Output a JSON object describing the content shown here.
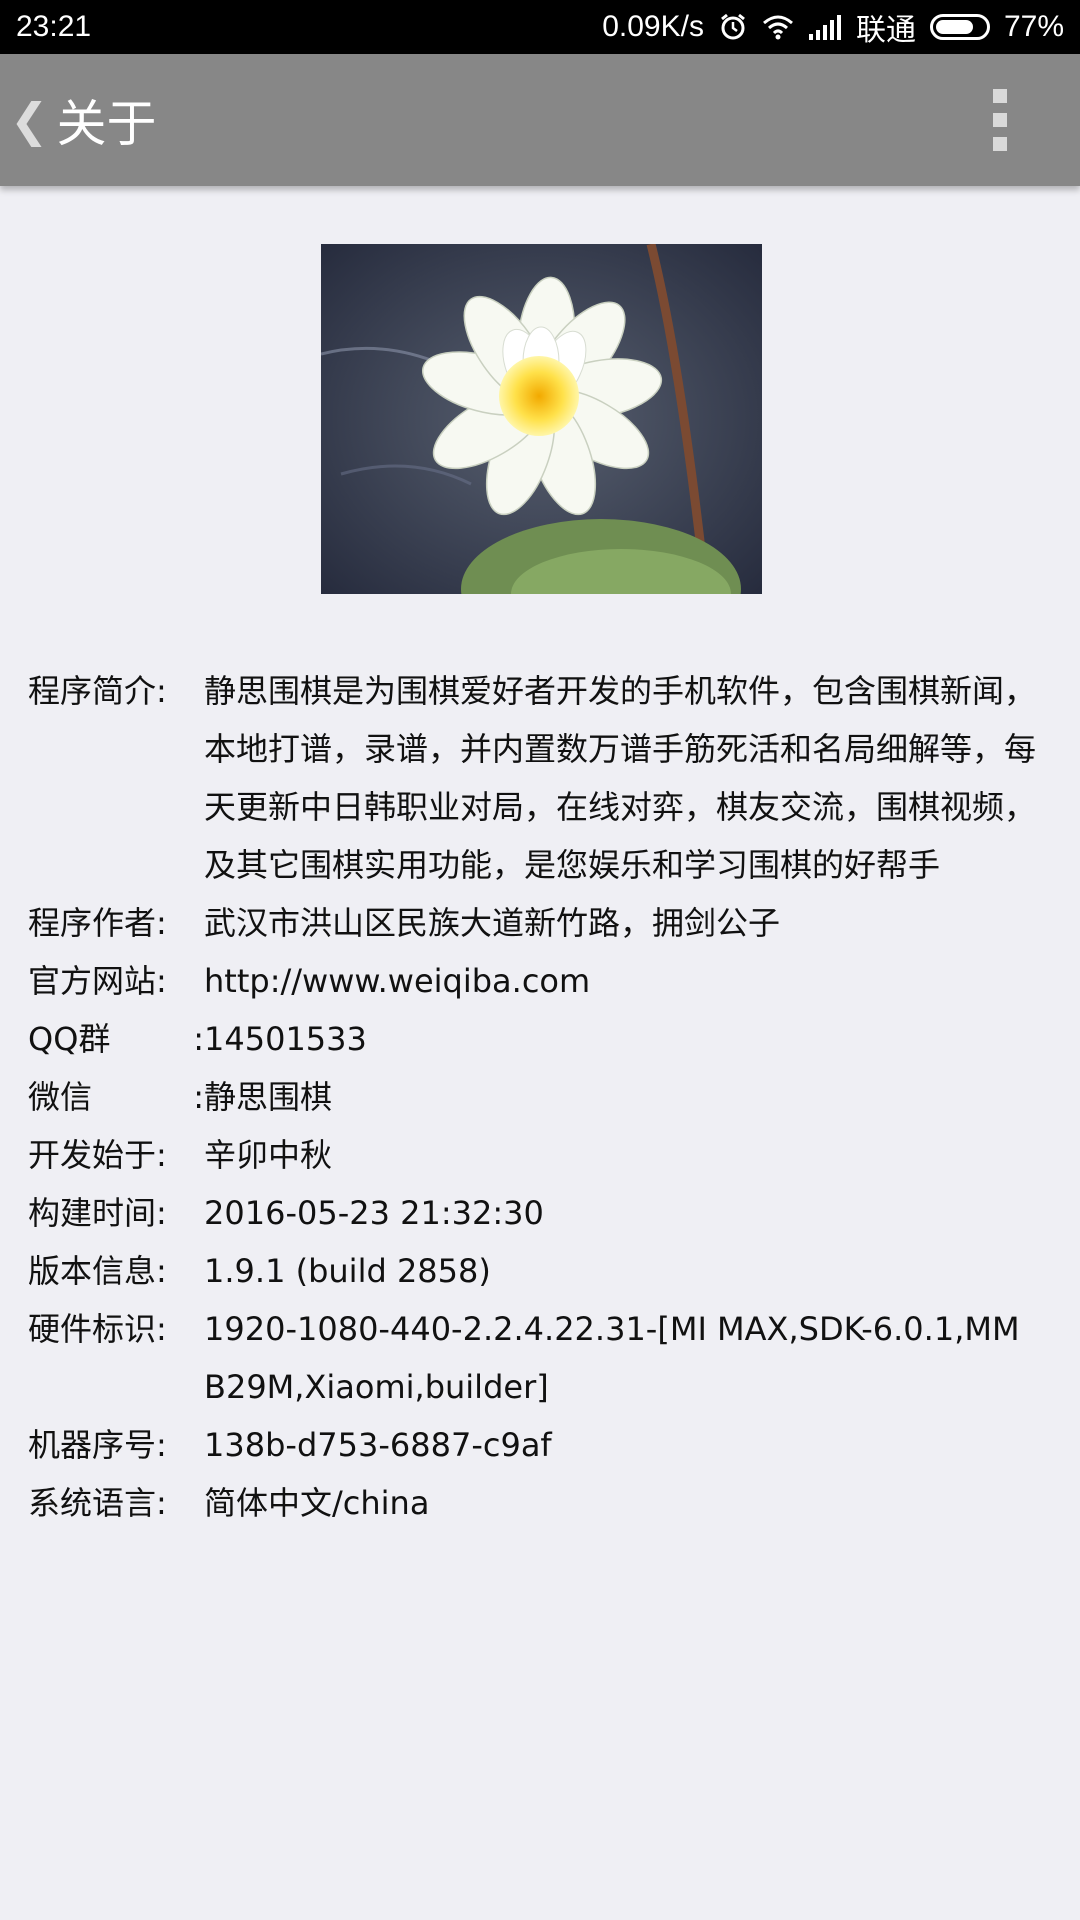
{
  "status_bar": {
    "time": "23:21",
    "speed": "0.09K/s",
    "carrier": "联通",
    "battery_text": "77%",
    "battery_level": 0.77,
    "icons": [
      "alarm-icon",
      "wifi-icon",
      "signal-icon",
      "battery-icon"
    ]
  },
  "header": {
    "back_icon": "chevron-left-icon",
    "title": "关于",
    "menu_icon": "more-vert-icon"
  },
  "info": {
    "intro_label": "程序简介:",
    "intro_value": "静思围棋是为围棋爱好者开发的手机软件，包含围棋新闻，本地打谱，录谱，并内置数万谱手筋死活和名局细解等，每天更新中日韩职业对局，在线对弈，棋友交流，围棋视频，及其它围棋实用功能，是您娱乐和学习围棋的好帮手",
    "author_label": "程序作者:",
    "author_value": "武汉市洪山区民族大道新竹路，拥剑公子",
    "site_label": "官方网站:",
    "site_value": "http://www.weiqiba.com",
    "qq_label": "QQ群",
    "qq_colon": ":",
    "qq_value": "14501533",
    "wechat_label": "微信",
    "wechat_colon": ":",
    "wechat_value": "静思围棋",
    "start_label": "开发始于:",
    "start_value": "辛卯中秋",
    "build_time_label": "构建时间:",
    "build_time_value": "2016-05-23 21:32:30",
    "version_label": "版本信息:",
    "version_value": "1.9.1 (build 2858)",
    "hardware_label": "硬件标识:",
    "hardware_value": "1920-1080-440-2.2.4.22.31-[MI MAX,SDK-6.0.1,MMB29M,Xiaomi,builder]",
    "serial_label": "机器序号:",
    "serial_value": "138b-d753-6887-c9af",
    "language_label": "系统语言:",
    "language_value": "简体中文/china"
  }
}
